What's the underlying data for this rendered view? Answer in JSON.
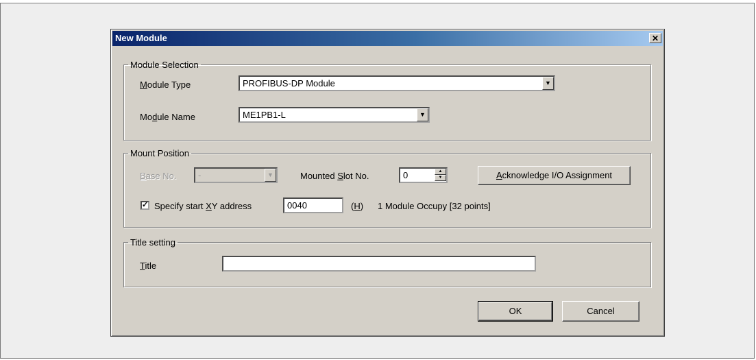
{
  "dialog": {
    "title": "New Module",
    "close_icon": "close-icon",
    "close_glyph": "✕"
  },
  "module_selection": {
    "legend": "Module Selection",
    "type_label_u": "M",
    "type_label_rest": "odule Type",
    "type_value": "PROFIBUS-DP Module",
    "name_label_pre": "Mo",
    "name_label_u": "d",
    "name_label_rest": "ule Name",
    "name_value": "ME1PB1-L"
  },
  "mount_position": {
    "legend": "Mount Position",
    "base_label_u": "B",
    "base_label_rest": "ase No.",
    "base_value": "-",
    "slot_label_pre": "Mounted ",
    "slot_label_u": "S",
    "slot_label_rest": "lot No.",
    "slot_value": "0",
    "ack_button_u": "A",
    "ack_button_rest": "cknowledge I/O Assignment",
    "specify_checked": true,
    "specify_label_pre": "Specify start ",
    "specify_label_u": "X",
    "specify_label_rest": "Y address",
    "address_value": "0040",
    "hex_u": "H",
    "occupy_text": "1 Module Occupy [32 points]"
  },
  "title_setting": {
    "legend": "Title setting",
    "title_label_u": "T",
    "title_label_rest": "itle",
    "title_value": ""
  },
  "buttons": {
    "ok": "OK",
    "cancel": "Cancel"
  },
  "glyphs": {
    "dropdown_arrow": "▼",
    "spin_up": "▲",
    "spin_down": "▼",
    "check": "✓"
  },
  "colors": {
    "titlebar_start": "#0a246a",
    "titlebar_end": "#a6caf0",
    "dialog_face": "#d4d0c8"
  }
}
